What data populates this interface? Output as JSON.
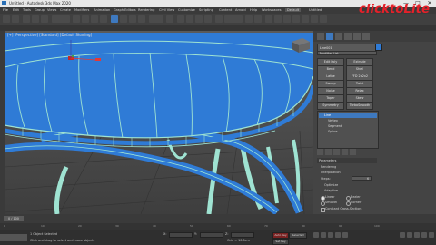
{
  "window": {
    "title": "Untitled - Autodesk 3ds Max 2020",
    "controls": {
      "minimize": "—",
      "maximize": "□",
      "close": "✕"
    }
  },
  "brand": {
    "text": "clicktoLite",
    "color": "#e5212a"
  },
  "menubar": {
    "items": [
      "File",
      "Edit",
      "Tools",
      "Group",
      "Views",
      "Create",
      "Modifiers",
      "Animation",
      "Graph Editors",
      "Rendering",
      "Civil View",
      "Customize",
      "Scripting",
      "Content",
      "Arnold",
      "Help",
      "Workspaces:",
      "Default",
      "Untitled"
    ]
  },
  "viewport": {
    "label": "[+] [Perspective] [Standard] [Default Shading]"
  },
  "command_panel": {
    "object_name": "Line001",
    "modifier_list": "Modifier List",
    "buttons": [
      "Edit Poly",
      "Extrude",
      "Bend",
      "Shell",
      "Lathe",
      "FFD 2x2x2",
      "Sweep",
      "Twist",
      "Noise",
      "Relax",
      "Taper",
      "Skew",
      "Symmetry",
      "TurboSmooth",
      "Face Extrude",
      "Smooth"
    ],
    "stack": [
      "Vertex",
      "Segment",
      "Spline"
    ],
    "stack_header": "Line",
    "selected_stack_item": "Line",
    "rollout_title": "Parameters",
    "params": [
      {
        "label": "Rendering",
        "value": ""
      },
      {
        "label": "Interpolation",
        "value": ""
      },
      {
        "label": "Steps:",
        "value": "6"
      },
      {
        "label": "Optimize",
        "value": ""
      },
      {
        "label": "Adaptive",
        "value": ""
      }
    ],
    "radio_options": [
      "Linear",
      "Smooth",
      "Bezier",
      "Corner"
    ],
    "checkbox_label": "Constant Cross-Section"
  },
  "timeline": {
    "frame_display": "0 / 100",
    "ticks": [
      "0",
      "10",
      "20",
      "30",
      "40",
      "50",
      "60",
      "70",
      "80",
      "90",
      "100"
    ]
  },
  "status": {
    "line1": "1 Object Selected",
    "line2": "Click and drag to select and move objects",
    "x_label": "X:",
    "y_label": "Y:",
    "z_label": "Z:",
    "grid": "Grid = 10.0cm",
    "auto_key": "Auto Key",
    "selected": "Selected",
    "set_key": "Set Key"
  },
  "colors": {
    "accent": "#3e79bf",
    "model_fill": "#2f7bd6",
    "wire": "#9fe3d2"
  }
}
